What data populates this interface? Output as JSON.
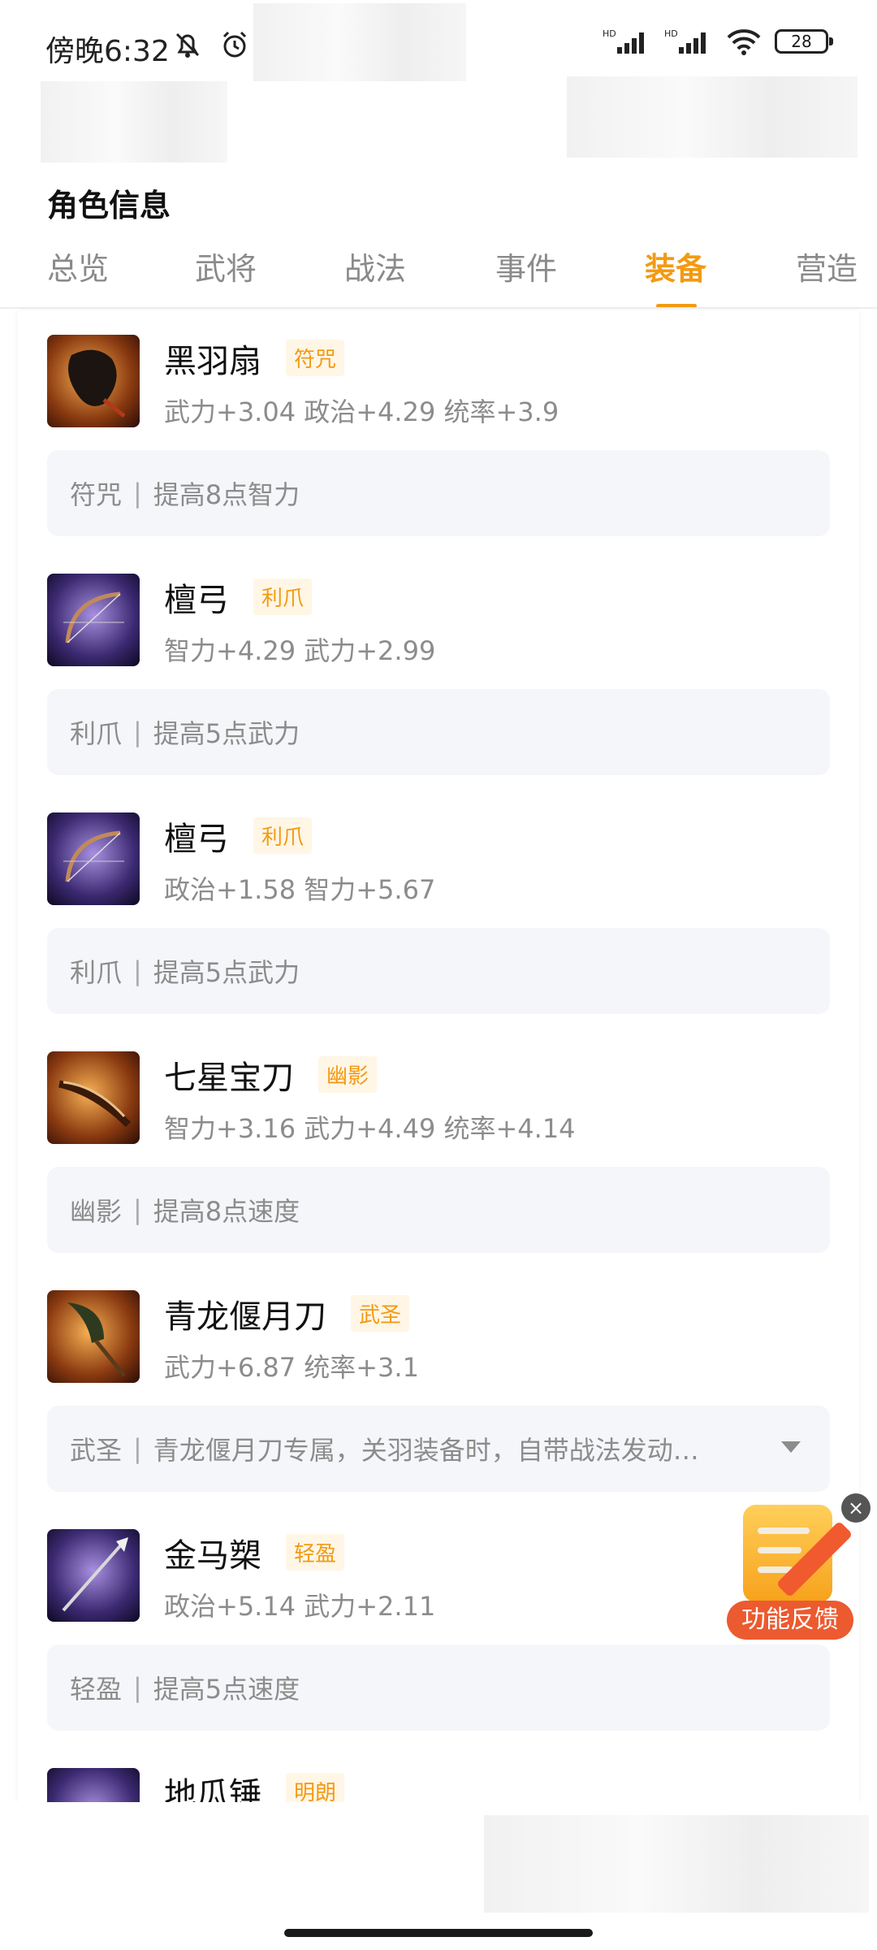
{
  "status_bar": {
    "time": "傍晚6:32",
    "battery": "28",
    "signal_label_1": "HD",
    "signal_label_2": "HD"
  },
  "page": {
    "title": "角色信息"
  },
  "tabs": [
    {
      "label": "总览"
    },
    {
      "label": "武将"
    },
    {
      "label": "战法"
    },
    {
      "label": "事件"
    },
    {
      "label": "装备"
    },
    {
      "label": "营造"
    }
  ],
  "active_tab": "装备",
  "equipment": [
    {
      "name": "黑羽扇",
      "tag": "符咒",
      "stats": "武力+3.04 政治+4.29 统率+3.9",
      "skill_name": "符咒",
      "skill_desc": "提高8点智力",
      "icon": "black-feather-fan-icon"
    },
    {
      "name": "檀弓",
      "tag": "利爪",
      "stats": "智力+4.29 武力+2.99",
      "skill_name": "利爪",
      "skill_desc": "提高5点武力",
      "icon": "bow-icon"
    },
    {
      "name": "檀弓",
      "tag": "利爪",
      "stats": "政治+1.58 智力+5.67",
      "skill_name": "利爪",
      "skill_desc": "提高5点武力",
      "icon": "bow-icon"
    },
    {
      "name": "七星宝刀",
      "tag": "幽影",
      "stats": "智力+3.16 武力+4.49 统率+4.14",
      "skill_name": "幽影",
      "skill_desc": "提高8点速度",
      "icon": "seven-star-sword-icon"
    },
    {
      "name": "青龙偃月刀",
      "tag": "武圣",
      "stats": "武力+6.87 统率+3.1",
      "skill_name": "武圣",
      "skill_desc": "青龙偃月刀专属，关羽装备时，自带战法发动…",
      "icon": "green-dragon-blade-icon"
    },
    {
      "name": "金马槊",
      "tag": "轻盈",
      "stats": "政治+5.14 武力+2.11",
      "skill_name": "轻盈",
      "skill_desc": "提高5点速度",
      "icon": "spear-icon"
    },
    {
      "name": "地瓜锤",
      "tag": "明朗",
      "stats": "",
      "skill_name": "",
      "skill_desc": "",
      "icon": "hammer-icon"
    }
  ],
  "feedback": {
    "label": "功能反馈",
    "close": "×"
  },
  "colors": {
    "accent": "#f39a12",
    "feedback": "#ec5a30"
  }
}
